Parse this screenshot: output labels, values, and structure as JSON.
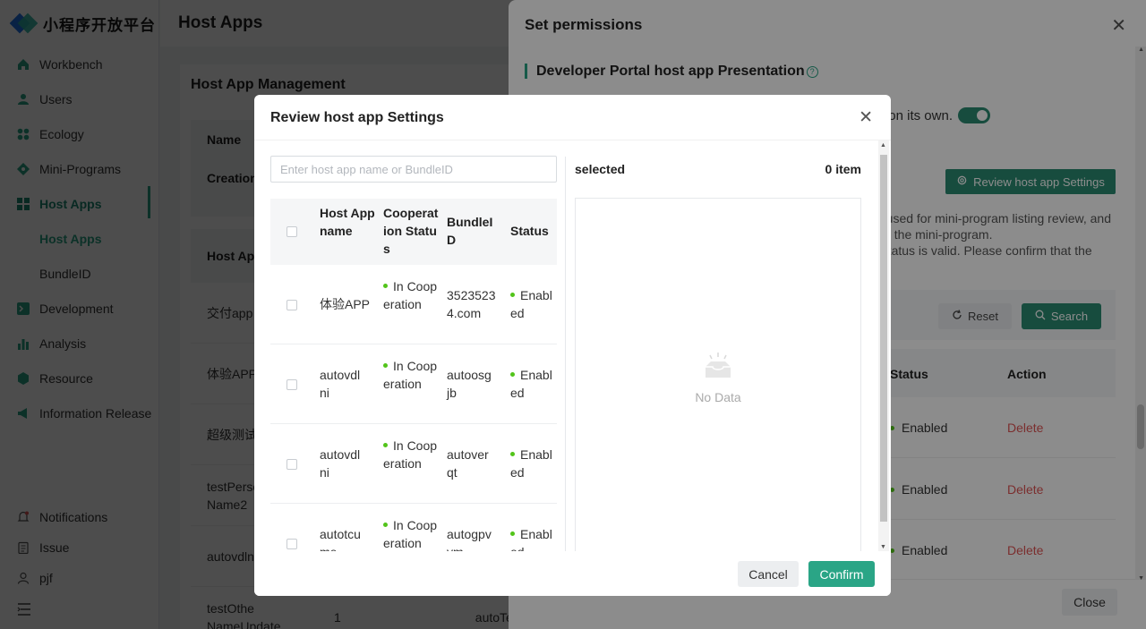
{
  "app": {
    "logo_text": "小程序开放平台"
  },
  "sidebar": {
    "items": [
      {
        "label": "Workbench",
        "icon": "home-icon"
      },
      {
        "label": "Users",
        "icon": "user-icon"
      },
      {
        "label": "Ecology",
        "icon": "grid-icon"
      },
      {
        "label": "Mini-Programs",
        "icon": "diamond-icon"
      },
      {
        "label": "Host Apps",
        "icon": "apps-icon",
        "active": true
      },
      {
        "label": "Host Apps",
        "sub": true,
        "active": true
      },
      {
        "label": "BundleID",
        "sub": true
      },
      {
        "label": "Development",
        "icon": "terminal-icon"
      },
      {
        "label": "Analysis",
        "icon": "bar-chart-icon"
      },
      {
        "label": "Resource",
        "icon": "cube-icon"
      },
      {
        "label": "Information Release",
        "icon": "megaphone-icon"
      }
    ],
    "bottom": [
      {
        "label": "Notifications",
        "icon": "bell-icon"
      },
      {
        "label": "Issue",
        "icon": "clipboard-icon"
      },
      {
        "label": "pjf",
        "icon": "person-icon"
      }
    ]
  },
  "header": {
    "title": "Host Apps"
  },
  "main": {
    "card_title": "Host App Management",
    "filter_labels": [
      "Name",
      "Creation"
    ],
    "table_head": "Host App",
    "rows": [
      {
        "c1": "交付app",
        "c2": ""
      },
      {
        "c1": "体验APP",
        "c2": ""
      },
      {
        "c1": "超级测试a",
        "c2": ""
      },
      {
        "c1": "testPerso Name2",
        "c2": ""
      },
      {
        "c1": "autovdln",
        "c2": ""
      },
      {
        "c1": "testOthe NameUpdate",
        "c2": "1",
        "c3": "autoTe"
      }
    ]
  },
  "drawer": {
    "title": "Set permissions",
    "section_title": "Developer Portal host app Presentation",
    "toggle_text": "on its own.",
    "review_button": "Review host app Settings",
    "desc_lines": [
      "used for mini-program listing review, and",
      "f the mini-program.",
      "g status is valid. Please confirm that the"
    ],
    "reset_label": "Reset",
    "search_label": "Search",
    "table": {
      "status_header": "Status",
      "action_header": "Action"
    },
    "rows": [
      {
        "status": "Enabled",
        "action": "Delete"
      },
      {
        "status": "Enabled",
        "action": "Delete"
      },
      {
        "status": "Enabled",
        "action": "Delete"
      }
    ],
    "close_label": "Close"
  },
  "dialog": {
    "title": "Review host app Settings",
    "search_placeholder": "Enter host app name or BundleID",
    "columns": {
      "name": "Host App name",
      "coop": "Cooperation Status",
      "bundle": "BundleID",
      "status": "Status"
    },
    "rows": [
      {
        "name": "体验APP",
        "coop": "In Cooperation",
        "bundle": "35235234.com",
        "status": "Enabled"
      },
      {
        "name": "autovdlni",
        "coop": "In Cooperation",
        "bundle": "autoosgjb",
        "status": "Enabled"
      },
      {
        "name": "autovdlni",
        "coop": "In Cooperation",
        "bundle": "autoverqt",
        "status": "Enabled"
      },
      {
        "name": "autotcume",
        "coop": "In Cooperation",
        "bundle": "autogpvym",
        "status": "Enabled"
      }
    ],
    "selected_label": "selected",
    "selected_count": "0 item",
    "empty_text": "No Data",
    "cancel_label": "Cancel",
    "confirm_label": "Confirm"
  },
  "colors": {
    "accent": "#2aa586",
    "accent_dark": "#2a8a72",
    "danger": "#e05555",
    "success": "#52c41a"
  }
}
